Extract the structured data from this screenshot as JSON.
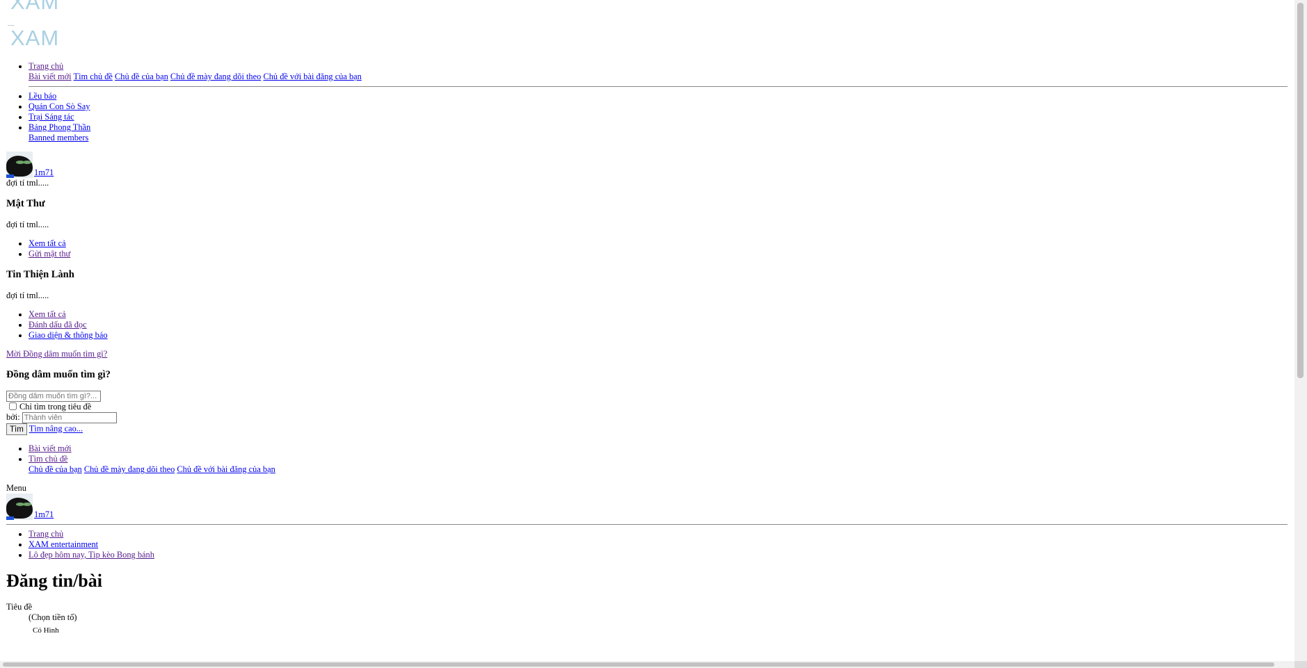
{
  "logo": {
    "text_top": "XAM",
    "text_main": "XAM"
  },
  "topnav": {
    "home": "Trang chủ",
    "sub": [
      "Bài viết mới",
      "Tìm chủ đề",
      "Chủ đề của bạn",
      "Chủ đề mày đang dõi theo",
      "Chủ đề với bài đăng của bạn"
    ]
  },
  "forums": {
    "items": [
      "Lều báo",
      "Quán Con Sò Say",
      "Trại Sáng tác",
      "Bảng Phong Thần"
    ],
    "banned": "Banned members"
  },
  "user": {
    "name": "1m71",
    "status": "đợi tí tml....."
  },
  "messages": {
    "heading": "Mật Thư",
    "status": "đợi tí tml.....",
    "links": [
      "Xem tất cả",
      "Gửi mật thư"
    ]
  },
  "alerts": {
    "heading": "Tin Thiện Lành",
    "status": "đợi tí tml.....",
    "links": [
      "Xem tất cả",
      "Đánh dấu đã đọc",
      "Giao diện & thông báo"
    ]
  },
  "search": {
    "toggle_link": "Mời Đồng dâm muốn tìm gì?",
    "heading": "Đồng dâm muốn tìm gì?",
    "query_placeholder": "Đồng dâm muốn tìm gì?...",
    "title_only_label": "Chỉ tìm trong tiêu đề",
    "by_label": "bởi:",
    "member_placeholder": "Thành viên",
    "submit_label": "Tìm",
    "advanced_link": "Tìm nâng cao..."
  },
  "whatsnew": {
    "new_posts": "Bài viết mới",
    "find_threads": "Tìm chủ đề",
    "sub": [
      "Chủ đề của bạn",
      "Chủ đề mày đang dõi theo",
      "Chủ đề với bài đăng của bạn"
    ]
  },
  "menu_label": "Menu",
  "breadcrumbs": [
    "Trang chủ",
    "XAM entertainment",
    "Lô đẹp hôm nay, Tip kèo Bong bánh"
  ],
  "page_title": "Đăng tin/bài",
  "form": {
    "title_label": "Tiêu đề",
    "prefix_selected": "(Chọn tiền tố)",
    "prefix_option": "Có Hình"
  }
}
